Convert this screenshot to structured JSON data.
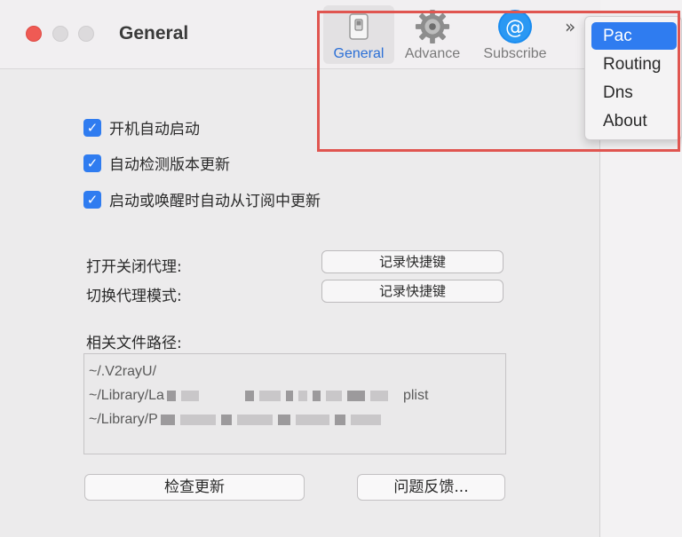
{
  "window": {
    "title": "General"
  },
  "toolbar": {
    "items": [
      {
        "label": "General",
        "icon": "switch-icon",
        "active": true
      },
      {
        "label": "Advance",
        "icon": "gear-icon",
        "active": false
      },
      {
        "label": "Subscribe",
        "icon": "at-sign-icon",
        "active": false
      }
    ],
    "overflow": "»"
  },
  "overflow_menu": {
    "items": [
      "Pac",
      "Routing",
      "Dns",
      "About"
    ],
    "selected": "Pac"
  },
  "checkboxes": [
    {
      "label": "开机自动启动",
      "checked": true
    },
    {
      "label": "自动检测版本更新",
      "checked": true
    },
    {
      "label": "启动或唤醒时自动从订阅中更新",
      "checked": true
    }
  ],
  "shortcuts": [
    {
      "label": "打开关闭代理:",
      "button": "记录快捷键"
    },
    {
      "label": "切换代理模式:",
      "button": "记录快捷键"
    }
  ],
  "paths": {
    "label": "相关文件路径:",
    "lines": [
      "~/.V2rayU/",
      "~/Library/La",
      "plist",
      "~/Library/P"
    ]
  },
  "buttons": {
    "check_update": "检查更新",
    "feedback": "问题反馈..."
  },
  "colors": {
    "accent": "#2f7cf0",
    "highlight": "#e05550"
  }
}
